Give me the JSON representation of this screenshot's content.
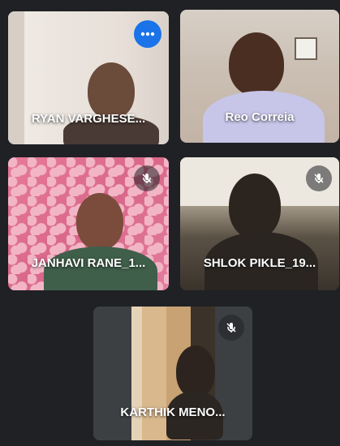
{
  "participants": [
    {
      "name": "RYAN VARGHESE...",
      "muted": false,
      "speaking": true,
      "more_menu": true
    },
    {
      "name": "Reo Correia",
      "muted": false,
      "speaking": false,
      "more_menu": false
    },
    {
      "name": "JANHAVI RANE_1...",
      "muted": true,
      "speaking": false,
      "more_menu": false
    },
    {
      "name": "SHLOK PIKLE_19...",
      "muted": true,
      "speaking": false,
      "more_menu": false
    },
    {
      "name": "KARTHIK MENO...",
      "muted": true,
      "speaking": false,
      "more_menu": false
    }
  ],
  "colors": {
    "background": "#202124",
    "speaking_border": "#8ab4f8",
    "more_button": "#1a73e8"
  },
  "icons": {
    "more": "more-vert-icon",
    "mute": "mic-off-icon"
  }
}
